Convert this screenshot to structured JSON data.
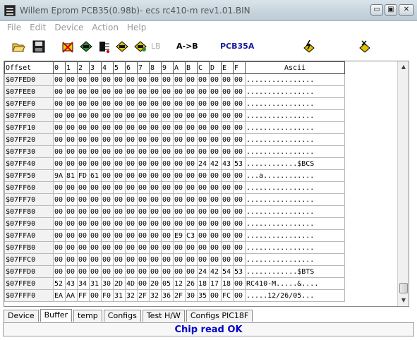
{
  "window": {
    "title": "Willem Eprom PCB35(0.98b)- ecs rc410-m rev1.01.BIN",
    "min_glyph": "▭",
    "max_glyph": "▣",
    "close_glyph": "✕"
  },
  "menu": [
    "File",
    "Edit",
    "Device",
    "Action",
    "Help"
  ],
  "toolbar": {
    "lb_label": "LB",
    "ab_label": "A->B",
    "pcb_label": "PCB35A"
  },
  "grid": {
    "headers": [
      "Offset",
      "0",
      "1",
      "2",
      "3",
      "4",
      "5",
      "6",
      "7",
      "8",
      "9",
      "A",
      "B",
      "C",
      "D",
      "E",
      "F",
      "Ascii"
    ],
    "rows": [
      {
        "offset": "$07FED0",
        "bytes": [
          "00",
          "00",
          "00",
          "00",
          "00",
          "00",
          "00",
          "00",
          "00",
          "00",
          "00",
          "00",
          "00",
          "00",
          "00",
          "00"
        ],
        "ascii": "................"
      },
      {
        "offset": "$07FEE0",
        "bytes": [
          "00",
          "00",
          "00",
          "00",
          "00",
          "00",
          "00",
          "00",
          "00",
          "00",
          "00",
          "00",
          "00",
          "00",
          "00",
          "00"
        ],
        "ascii": "................"
      },
      {
        "offset": "$07FEF0",
        "bytes": [
          "00",
          "00",
          "00",
          "00",
          "00",
          "00",
          "00",
          "00",
          "00",
          "00",
          "00",
          "00",
          "00",
          "00",
          "00",
          "00"
        ],
        "ascii": "................"
      },
      {
        "offset": "$07FF00",
        "bytes": [
          "00",
          "00",
          "00",
          "00",
          "00",
          "00",
          "00",
          "00",
          "00",
          "00",
          "00",
          "00",
          "00",
          "00",
          "00",
          "00"
        ],
        "ascii": "................"
      },
      {
        "offset": "$07FF10",
        "bytes": [
          "00",
          "00",
          "00",
          "00",
          "00",
          "00",
          "00",
          "00",
          "00",
          "00",
          "00",
          "00",
          "00",
          "00",
          "00",
          "00"
        ],
        "ascii": "................"
      },
      {
        "offset": "$07FF20",
        "bytes": [
          "00",
          "00",
          "00",
          "00",
          "00",
          "00",
          "00",
          "00",
          "00",
          "00",
          "00",
          "00",
          "00",
          "00",
          "00",
          "00"
        ],
        "ascii": "................"
      },
      {
        "offset": "$07FF30",
        "bytes": [
          "00",
          "00",
          "00",
          "00",
          "00",
          "00",
          "00",
          "00",
          "00",
          "00",
          "00",
          "00",
          "00",
          "00",
          "00",
          "00"
        ],
        "ascii": "................"
      },
      {
        "offset": "$07FF40",
        "bytes": [
          "00",
          "00",
          "00",
          "00",
          "00",
          "00",
          "00",
          "00",
          "00",
          "00",
          "00",
          "00",
          "24",
          "42",
          "43",
          "53"
        ],
        "ascii": "............$BCS"
      },
      {
        "offset": "$07FF50",
        "bytes": [
          "9A",
          "81",
          "FD",
          "61",
          "00",
          "00",
          "00",
          "00",
          "00",
          "00",
          "00",
          "00",
          "00",
          "00",
          "00",
          "00"
        ],
        "ascii": "...a............"
      },
      {
        "offset": "$07FF60",
        "bytes": [
          "00",
          "00",
          "00",
          "00",
          "00",
          "00",
          "00",
          "00",
          "00",
          "00",
          "00",
          "00",
          "00",
          "00",
          "00",
          "00"
        ],
        "ascii": "................"
      },
      {
        "offset": "$07FF70",
        "bytes": [
          "00",
          "00",
          "00",
          "00",
          "00",
          "00",
          "00",
          "00",
          "00",
          "00",
          "00",
          "00",
          "00",
          "00",
          "00",
          "00"
        ],
        "ascii": "................"
      },
      {
        "offset": "$07FF80",
        "bytes": [
          "00",
          "00",
          "00",
          "00",
          "00",
          "00",
          "00",
          "00",
          "00",
          "00",
          "00",
          "00",
          "00",
          "00",
          "00",
          "00"
        ],
        "ascii": "................"
      },
      {
        "offset": "$07FF90",
        "bytes": [
          "00",
          "00",
          "00",
          "00",
          "00",
          "00",
          "00",
          "00",
          "00",
          "00",
          "00",
          "00",
          "00",
          "00",
          "00",
          "00"
        ],
        "ascii": "................"
      },
      {
        "offset": "$07FFA0",
        "bytes": [
          "00",
          "00",
          "00",
          "00",
          "00",
          "00",
          "00",
          "00",
          "00",
          "00",
          "E9",
          "C3",
          "00",
          "00",
          "00",
          "00"
        ],
        "ascii": "................"
      },
      {
        "offset": "$07FFB0",
        "bytes": [
          "00",
          "00",
          "00",
          "00",
          "00",
          "00",
          "00",
          "00",
          "00",
          "00",
          "00",
          "00",
          "00",
          "00",
          "00",
          "00"
        ],
        "ascii": "................"
      },
      {
        "offset": "$07FFC0",
        "bytes": [
          "00",
          "00",
          "00",
          "00",
          "00",
          "00",
          "00",
          "00",
          "00",
          "00",
          "00",
          "00",
          "00",
          "00",
          "00",
          "00"
        ],
        "ascii": "................"
      },
      {
        "offset": "$07FFD0",
        "bytes": [
          "00",
          "00",
          "00",
          "00",
          "00",
          "00",
          "00",
          "00",
          "00",
          "00",
          "00",
          "00",
          "24",
          "42",
          "54",
          "53"
        ],
        "ascii": "............$BTS"
      },
      {
        "offset": "$07FFE0",
        "bytes": [
          "52",
          "43",
          "34",
          "31",
          "30",
          "2D",
          "4D",
          "00",
          "20",
          "05",
          "12",
          "26",
          "18",
          "17",
          "18",
          "00"
        ],
        "ascii": "RC410-M.....&...."
      },
      {
        "offset": "$07FFF0",
        "bytes": [
          "EA",
          "AA",
          "FF",
          "00",
          "F0",
          "31",
          "32",
          "2F",
          "32",
          "36",
          "2F",
          "30",
          "35",
          "00",
          "FC",
          "00"
        ],
        "ascii": ".....12/26/05..."
      }
    ]
  },
  "tabs": [
    "Device",
    "Buffer",
    "temp",
    "Configs",
    "Test H/W",
    "Configs PIC18F"
  ],
  "active_tab": "Buffer",
  "status": {
    "message": "Chip read OK",
    "color": "#0000cc"
  },
  "colors": {
    "pcb_label": "#1a1aa0",
    "icon_green": "#2e8b2e",
    "icon_yellow": "#e0c000"
  }
}
